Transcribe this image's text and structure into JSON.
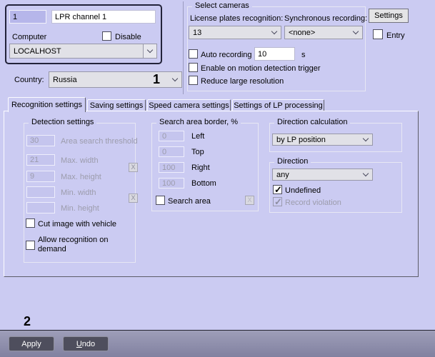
{
  "colors": {
    "background": "#cbcbf2",
    "footer_top": "#9e9eb9",
    "footer_bottom": "#8181a0",
    "footer_button": "#4e4e5d",
    "channel_box_border": "#23233a",
    "disabled_text": "#9c9cac"
  },
  "channel": {
    "id": "1",
    "name": "LPR channel 1",
    "computer_label": "Computer",
    "disable_label": "Disable",
    "computer_value": "LOCALHOST",
    "country_label": "Country:",
    "country_value": "Russia"
  },
  "annotations": {
    "one": "1",
    "two": "2"
  },
  "select_cameras": {
    "title": "Select cameras",
    "lpr_label": "License plates recognition:",
    "lpr_value": "13",
    "sync_label": "Synchronous recording:",
    "sync_value": "<none>",
    "auto_recording_label": "Auto recording",
    "auto_recording_value": "10",
    "seconds_label": "s",
    "motion_label": "Enable on motion detection trigger",
    "reduce_label": "Reduce large resolution"
  },
  "settings_button_label": "Settings",
  "entry_label": "Entry",
  "tabs": [
    {
      "label": "Recognition settings"
    },
    {
      "label": "Saving settings"
    },
    {
      "label": "Speed camera settings"
    },
    {
      "label": "Settings of LP processing"
    }
  ],
  "detection": {
    "title": "Detection settings",
    "fields": [
      {
        "value": "30",
        "label": "Area search threshold"
      },
      {
        "value": "21",
        "label": "Max. width"
      },
      {
        "value": "9",
        "label": "Max. height"
      },
      {
        "value": "",
        "label": "Min. width"
      },
      {
        "value": "",
        "label": "Min. height"
      }
    ],
    "cut_image_label": "Cut image with vehicle",
    "allow_recognition_label": "Allow recognition on demand"
  },
  "search_area": {
    "title": "Search area border, %",
    "fields": [
      {
        "value": "0",
        "label": "Left"
      },
      {
        "value": "0",
        "label": "Top"
      },
      {
        "value": "100",
        "label": "Right"
      },
      {
        "value": "100",
        "label": "Bottom"
      }
    ],
    "checkbox_label": "Search area"
  },
  "clear_button_label": "X",
  "direction_calculation": {
    "title": "Direction calculation",
    "value": "by LP position"
  },
  "direction": {
    "title": "Direction",
    "value": "any",
    "undefined_label": "Undefined",
    "record_violation_label": "Record violation"
  },
  "footer": {
    "apply_label": "Apply",
    "undo_label": "Undo"
  }
}
